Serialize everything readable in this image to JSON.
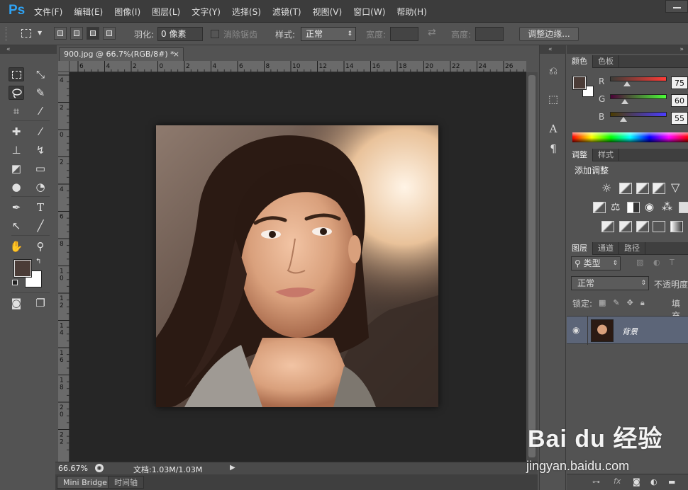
{
  "app": {
    "logo": "Ps"
  },
  "menu": [
    "文件(F)",
    "编辑(E)",
    "图像(I)",
    "图层(L)",
    "文字(Y)",
    "选择(S)",
    "滤镜(T)",
    "视图(V)",
    "窗口(W)",
    "帮助(H)"
  ],
  "options": {
    "feather_label": "羽化:",
    "feather_value": "0 像素",
    "antialias_label": "消除锯齿",
    "style_label": "样式:",
    "style_value": "正常",
    "width_label": "宽度:",
    "height_label": "高度:",
    "refine_edge_button": "调整边缘..."
  },
  "document": {
    "tab_title": "900.jpg @ 66.7%(RGB/8#) *",
    "close_glyph": "×",
    "h_ruler": [
      "6",
      "4",
      "2",
      "0",
      "2",
      "4",
      "6",
      "8",
      "10",
      "12",
      "14",
      "16",
      "18",
      "20",
      "22",
      "24",
      "26"
    ],
    "v_ruler": [
      "4",
      "2",
      "0",
      "2",
      "4",
      "6",
      "8",
      "1 0",
      "1 2",
      "1 4",
      "1 6",
      "1 8",
      "2 0",
      "2 2"
    ]
  },
  "status": {
    "zoom": "66.67%",
    "doc_info": "文档:1.03M/1.03M"
  },
  "bottom_tabs": [
    "Mini Bridge",
    "时间轴"
  ],
  "color_panel": {
    "tabs": [
      "颜色",
      "色板"
    ],
    "channels": [
      {
        "name": "R",
        "value": "75"
      },
      {
        "name": "G",
        "value": "60"
      },
      {
        "name": "B",
        "value": "55"
      }
    ],
    "foreground": "#4b3c37",
    "background": "#ffffff"
  },
  "adjust_panel": {
    "tabs": [
      "调整",
      "样式"
    ],
    "title": "添加调整"
  },
  "layers_panel": {
    "tabs": [
      "图层",
      "通道",
      "路径"
    ],
    "filter_kind": "类型",
    "blend_mode": "正常",
    "opacity_label": "不透明度",
    "lock_label": "锁定:",
    "fill_label": "填充",
    "layer_name": "背景"
  },
  "watermark": {
    "brand": "Bai du 经验",
    "url": "jingyan.baidu.com"
  },
  "colors": {
    "ps_blue": "#2fa3f4",
    "layer_selected": "#5c6578",
    "canvas_bg": "#262626"
  }
}
